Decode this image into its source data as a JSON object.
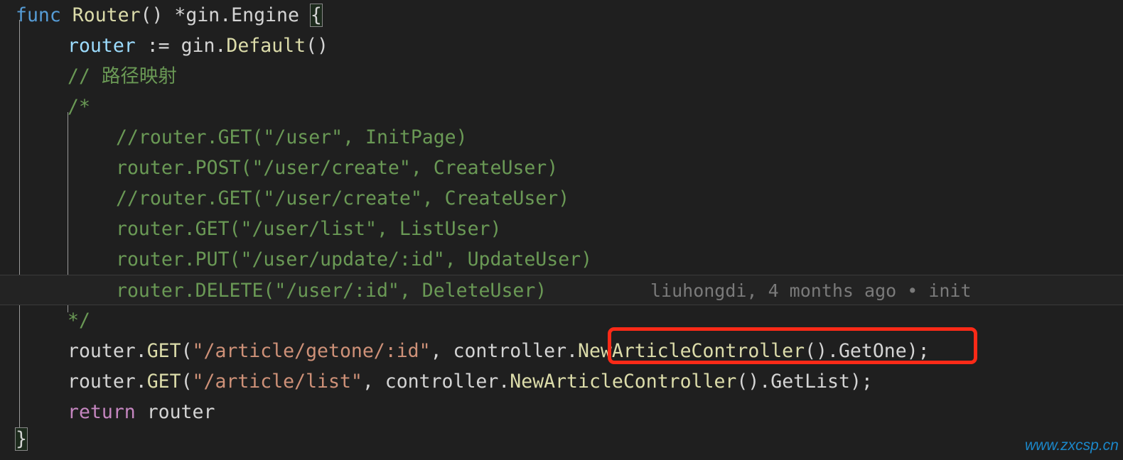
{
  "editor": {
    "language": "go",
    "theme": "dark",
    "background_color": "#1f1f1f",
    "font_size_px": 26,
    "line_height_px": 43
  },
  "colors": {
    "background": "#1f1f1f",
    "foreground": "#d4d4d4",
    "keyword": "#569cd6",
    "control_keyword": "#c586c0",
    "function": "#dcdcaa",
    "variable": "#9cdcfe",
    "string": "#ce9178",
    "comment": "#6a9955",
    "blame_text": "#7a7a7a",
    "annotation_red": "#fb2a17",
    "watermark": "#1b87c9",
    "current_line": "#232323",
    "brace_match_bg": "#1d2b1d",
    "indent_guide": "#9a9a9a"
  },
  "code": {
    "lines": [
      {
        "id": "line-func-router",
        "indent": "",
        "tokens": [
          {
            "text": "func",
            "type": "keyword"
          },
          {
            "text": " ",
            "type": "plain"
          },
          {
            "text": "Router",
            "type": "function"
          },
          {
            "text": "() ",
            "type": "punct"
          },
          {
            "text": "*gin.Engine ",
            "type": "plain"
          },
          {
            "text": "{",
            "type": "brace-match"
          }
        ]
      },
      {
        "id": "line-router-default",
        "indent": "  ",
        "tokens": [
          {
            "text": "router",
            "type": "variable"
          },
          {
            "text": " := ",
            "type": "punct"
          },
          {
            "text": "gin.",
            "type": "plain"
          },
          {
            "text": "Default",
            "type": "function"
          },
          {
            "text": "()",
            "type": "punct"
          }
        ]
      },
      {
        "id": "line-comment-path-mapping",
        "indent": "  ",
        "tokens": [
          {
            "text": "// 路径映射",
            "type": "comment"
          }
        ]
      },
      {
        "id": "line-block-comment-open",
        "indent": "  ",
        "tokens": [
          {
            "text": "/*",
            "type": "comment"
          }
        ]
      },
      {
        "id": "line-commented-get-user",
        "indent": "      ",
        "tokens": [
          {
            "text": "//router.GET(\"/user\", InitPage)",
            "type": "comment"
          }
        ]
      },
      {
        "id": "line-commented-post-user-create",
        "indent": "      ",
        "tokens": [
          {
            "text": "router.POST(\"/user/create\", CreateUser)",
            "type": "comment"
          }
        ]
      },
      {
        "id": "line-commented-get-user-create",
        "indent": "      ",
        "tokens": [
          {
            "text": "//router.GET(\"/user/create\", CreateUser)",
            "type": "comment"
          }
        ]
      },
      {
        "id": "line-commented-get-user-list",
        "indent": "      ",
        "tokens": [
          {
            "text": "router.GET(\"/user/list\", ListUser)",
            "type": "comment"
          }
        ]
      },
      {
        "id": "line-commented-put-user-update",
        "indent": "      ",
        "tokens": [
          {
            "text": "router.PUT(\"/user/update/:id\", UpdateUser)",
            "type": "comment"
          }
        ]
      },
      {
        "id": "line-commented-delete-user",
        "indent": "      ",
        "current": true,
        "tokens": [
          {
            "text": "router.DELETE(\"/user/:id\", DeleteUser)",
            "type": "comment"
          }
        ]
      },
      {
        "id": "line-block-comment-close",
        "indent": "  ",
        "tokens": [
          {
            "text": "*/",
            "type": "comment"
          }
        ]
      },
      {
        "id": "line-get-article-getone",
        "indent": "  ",
        "tokens": [
          {
            "text": "router.",
            "type": "plain"
          },
          {
            "text": "GET",
            "type": "function"
          },
          {
            "text": "(",
            "type": "punct"
          },
          {
            "text": "\"/article/getone/:id\"",
            "type": "string"
          },
          {
            "text": ", controller.",
            "type": "plain"
          },
          {
            "text": "NewArticleController",
            "type": "function"
          },
          {
            "text": "().",
            "type": "punct"
          },
          {
            "text": "GetOne",
            "type": "plain"
          },
          {
            "text": ");",
            "type": "punct"
          }
        ]
      },
      {
        "id": "line-get-article-list",
        "indent": "  ",
        "tokens": [
          {
            "text": "router.",
            "type": "plain"
          },
          {
            "text": "GET",
            "type": "function"
          },
          {
            "text": "(",
            "type": "punct"
          },
          {
            "text": "\"/article/list\"",
            "type": "string"
          },
          {
            "text": ", controller.",
            "type": "plain"
          },
          {
            "text": "NewArticleController",
            "type": "function"
          },
          {
            "text": "().",
            "type": "punct"
          },
          {
            "text": "GetList",
            "type": "plain"
          },
          {
            "text": ");",
            "type": "punct"
          }
        ]
      },
      {
        "id": "line-return-router",
        "indent": "  ",
        "tokens": [
          {
            "text": "return",
            "type": "control-keyword"
          },
          {
            "text": " router",
            "type": "plain"
          }
        ]
      },
      {
        "id": "line-closing-brace",
        "indent": "",
        "tokens": [
          {
            "text": "}",
            "type": "brace-match"
          }
        ]
      }
    ]
  },
  "git_blame": {
    "author": "liuhongdi",
    "time_ago": "4 months ago",
    "separator": "•",
    "commit_message": "init",
    "full_text": "liuhongdi, 4 months ago • init",
    "on_line_id": "line-commented-delete-user"
  },
  "annotation": {
    "type": "red-rectangle",
    "label": "NewArticleController().GetOne",
    "color": "#fb2a17",
    "on_line_id": "line-get-article-getone"
  },
  "watermark": {
    "text": "www.zxcsp.cn",
    "color": "#1b87c9"
  }
}
